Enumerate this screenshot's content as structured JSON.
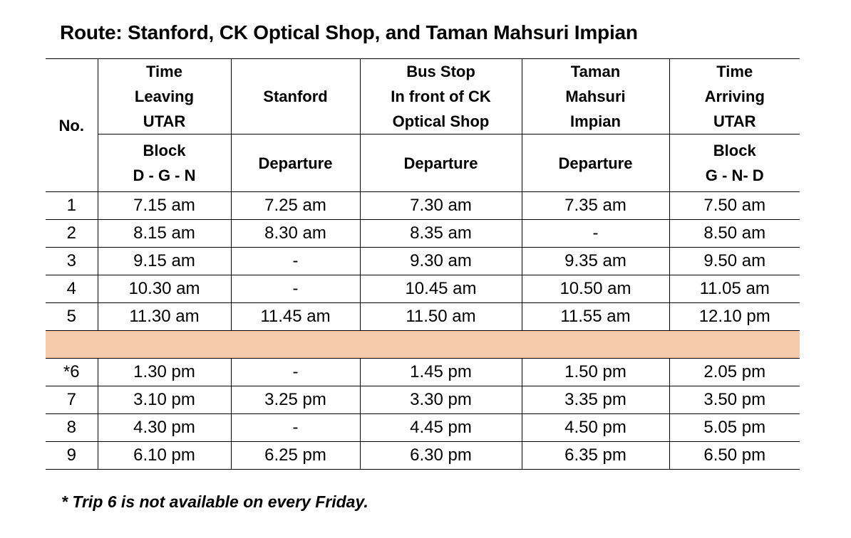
{
  "title": "Route: Stanford, CK Optical Shop, and Taman Mahsuri Impian",
  "header": {
    "no": "No.",
    "col1_top": [
      "Time",
      "Leaving",
      "UTAR"
    ],
    "col2_top": "Stanford",
    "col3_top": [
      "Bus Stop",
      "In front of CK",
      "Optical Shop"
    ],
    "col4_top": [
      "Taman",
      "Mahsuri",
      "Impian"
    ],
    "col5_top": [
      "Time",
      "Arriving",
      "UTAR"
    ],
    "col1_sub": [
      "Block",
      "D - G - N"
    ],
    "col2_sub": "Departure",
    "col3_sub": "Departure",
    "col4_sub": "Departure",
    "col5_sub": [
      "Block",
      "G - N- D"
    ]
  },
  "rows_morning": [
    [
      "1",
      "7.15 am",
      "7.25 am",
      "7.30 am",
      "7.35 am",
      "7.50 am"
    ],
    [
      "2",
      "8.15 am",
      "8.30 am",
      "8.35 am",
      "-",
      "8.50 am"
    ],
    [
      "3",
      "9.15 am",
      "-",
      "9.30 am",
      "9.35 am",
      "9.50 am"
    ],
    [
      "4",
      "10.30 am",
      "-",
      "10.45 am",
      "10.50 am",
      "11.05 am"
    ],
    [
      "5",
      "11.30 am",
      "11.45 am",
      "11.50 am",
      "11.55 am",
      "12.10 pm"
    ]
  ],
  "rows_afternoon": [
    [
      "*6",
      "1.30 pm",
      "-",
      "1.45 pm",
      "1.50 pm",
      "2.05 pm"
    ],
    [
      "7",
      "3.10 pm",
      "3.25 pm",
      "3.30 pm",
      "3.35 pm",
      "3.50 pm"
    ],
    [
      "8",
      "4.30 pm",
      "-",
      "4.45 pm",
      "4.50 pm",
      "5.05 pm"
    ],
    [
      "9",
      "6.10 pm",
      "6.25 pm",
      "6.30 pm",
      "6.35 pm",
      "6.50 pm"
    ]
  ],
  "break_color": "#f7caac",
  "note": "* Trip 6 is not available on every Friday."
}
